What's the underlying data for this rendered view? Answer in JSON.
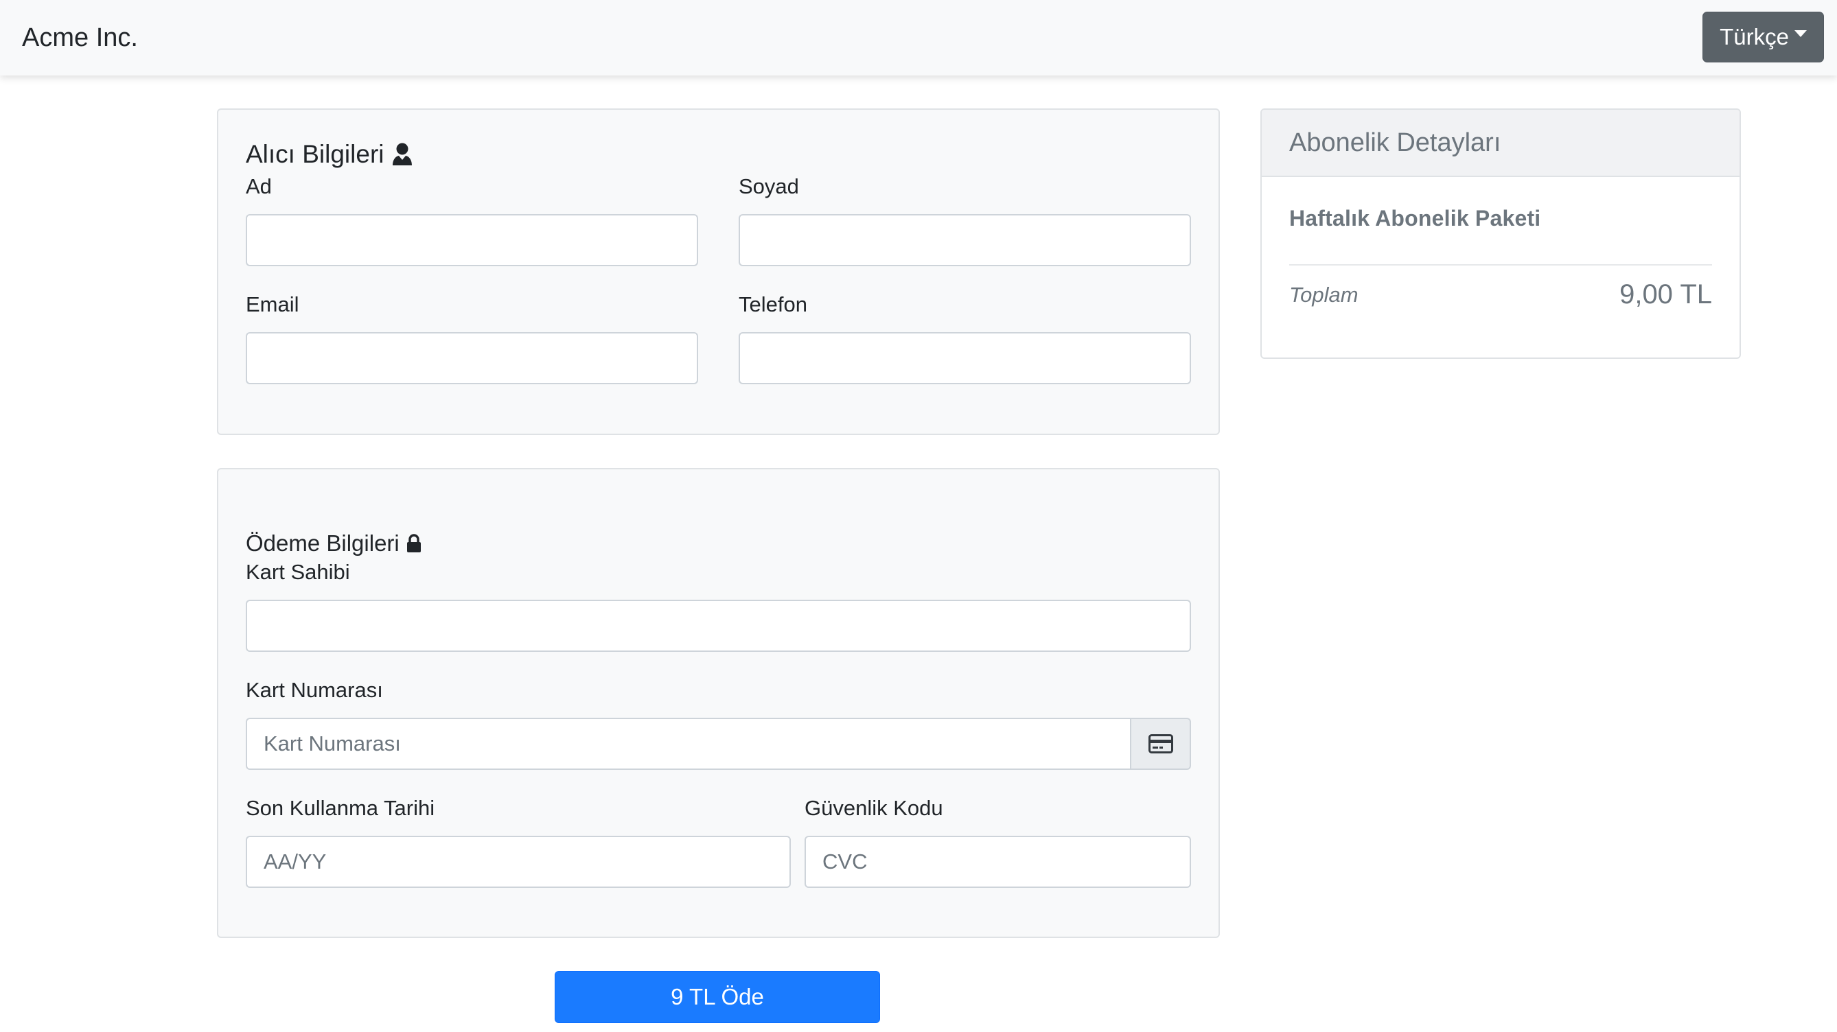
{
  "navbar": {
    "brand": "Acme Inc.",
    "language": "Türkçe"
  },
  "buyer": {
    "title": "Alıcı Bilgileri",
    "icon": "user-icon",
    "first_name_label": "Ad",
    "first_name_value": "",
    "last_name_label": "Soyad",
    "last_name_value": "",
    "email_label": "Email",
    "email_value": "",
    "phone_label": "Telefon",
    "phone_value": ""
  },
  "payment": {
    "title": "Ödeme Bilgileri",
    "icon": "lock-icon",
    "card_holder_label": "Kart Sahibi",
    "card_holder_value": "",
    "card_number_label": "Kart Numarası",
    "card_number_placeholder": "Kart Numarası",
    "card_icon": "credit-card-icon",
    "expiry_label": "Son Kullanma Tarihi",
    "expiry_placeholder": "AA/YY",
    "cvc_label": "Güvenlik Kodu",
    "cvc_placeholder": "CVC"
  },
  "pay_button": "9 TL Öde",
  "summary": {
    "title": "Abonelik Detayları",
    "plan_name": "Haftalık Abonelik Paketi",
    "total_label": "Toplam",
    "total_value": "9,00 TL"
  },
  "colors": {
    "primary": "#1a7bff",
    "language_button": "#5a6268",
    "card_background": "#f8f9fa"
  }
}
